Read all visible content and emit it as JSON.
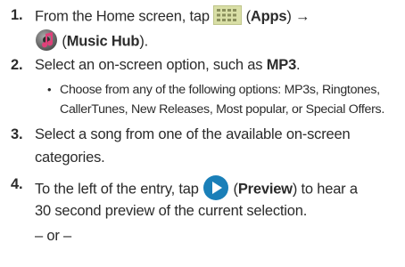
{
  "step1": {
    "num": "1.",
    "text_a": "From the Home screen, tap",
    "apps_open": "(",
    "apps_label": "Apps",
    "apps_close": ") →",
    "music_open": "(",
    "music_label": "Music Hub",
    "music_close": ")."
  },
  "step2": {
    "num": "2.",
    "text_a": "Select an on-screen option, such as",
    "option": "MP3",
    "period": "."
  },
  "bullet": {
    "dot": "•",
    "line1": "Choose from any of the following options: MP3s, Ringtones,",
    "line2": "CallerTunes, New Releases, Most popular, or Special Offers."
  },
  "step3": {
    "num": "3.",
    "line1": "Select a song from one of the available on-screen",
    "line2": "categories."
  },
  "step4": {
    "num": "4.",
    "text_a": "To the left of the entry, tap",
    "preview_open": "(",
    "preview_label": "Preview",
    "preview_close": ") to hear a",
    "line2": "30 second preview of the current selection.",
    "or_line": "– or –"
  },
  "icons": {
    "apps": "apps-grid-icon",
    "music": "music-hub-icon",
    "preview": "preview-play-icon"
  },
  "colors": {
    "text": "#2b2b2b",
    "apps_bg": "#d9dfa6",
    "preview_circle": "#1a7fb8",
    "music_pink": "#e0407a"
  }
}
